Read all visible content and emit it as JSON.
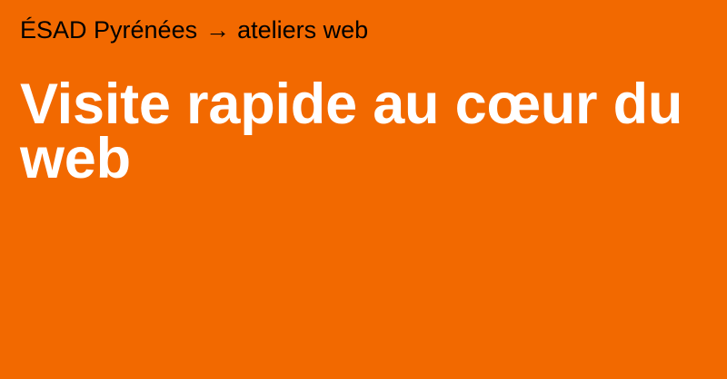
{
  "header": {
    "site_name": "ÉSAD Pyrénées",
    "separator": "→",
    "section": "ateliers web"
  },
  "main": {
    "title": "Visite rapide au cœur du web"
  },
  "colors": {
    "background": "#f26900",
    "breadcrumb_text": "#000000",
    "title_text": "#ffffff"
  }
}
